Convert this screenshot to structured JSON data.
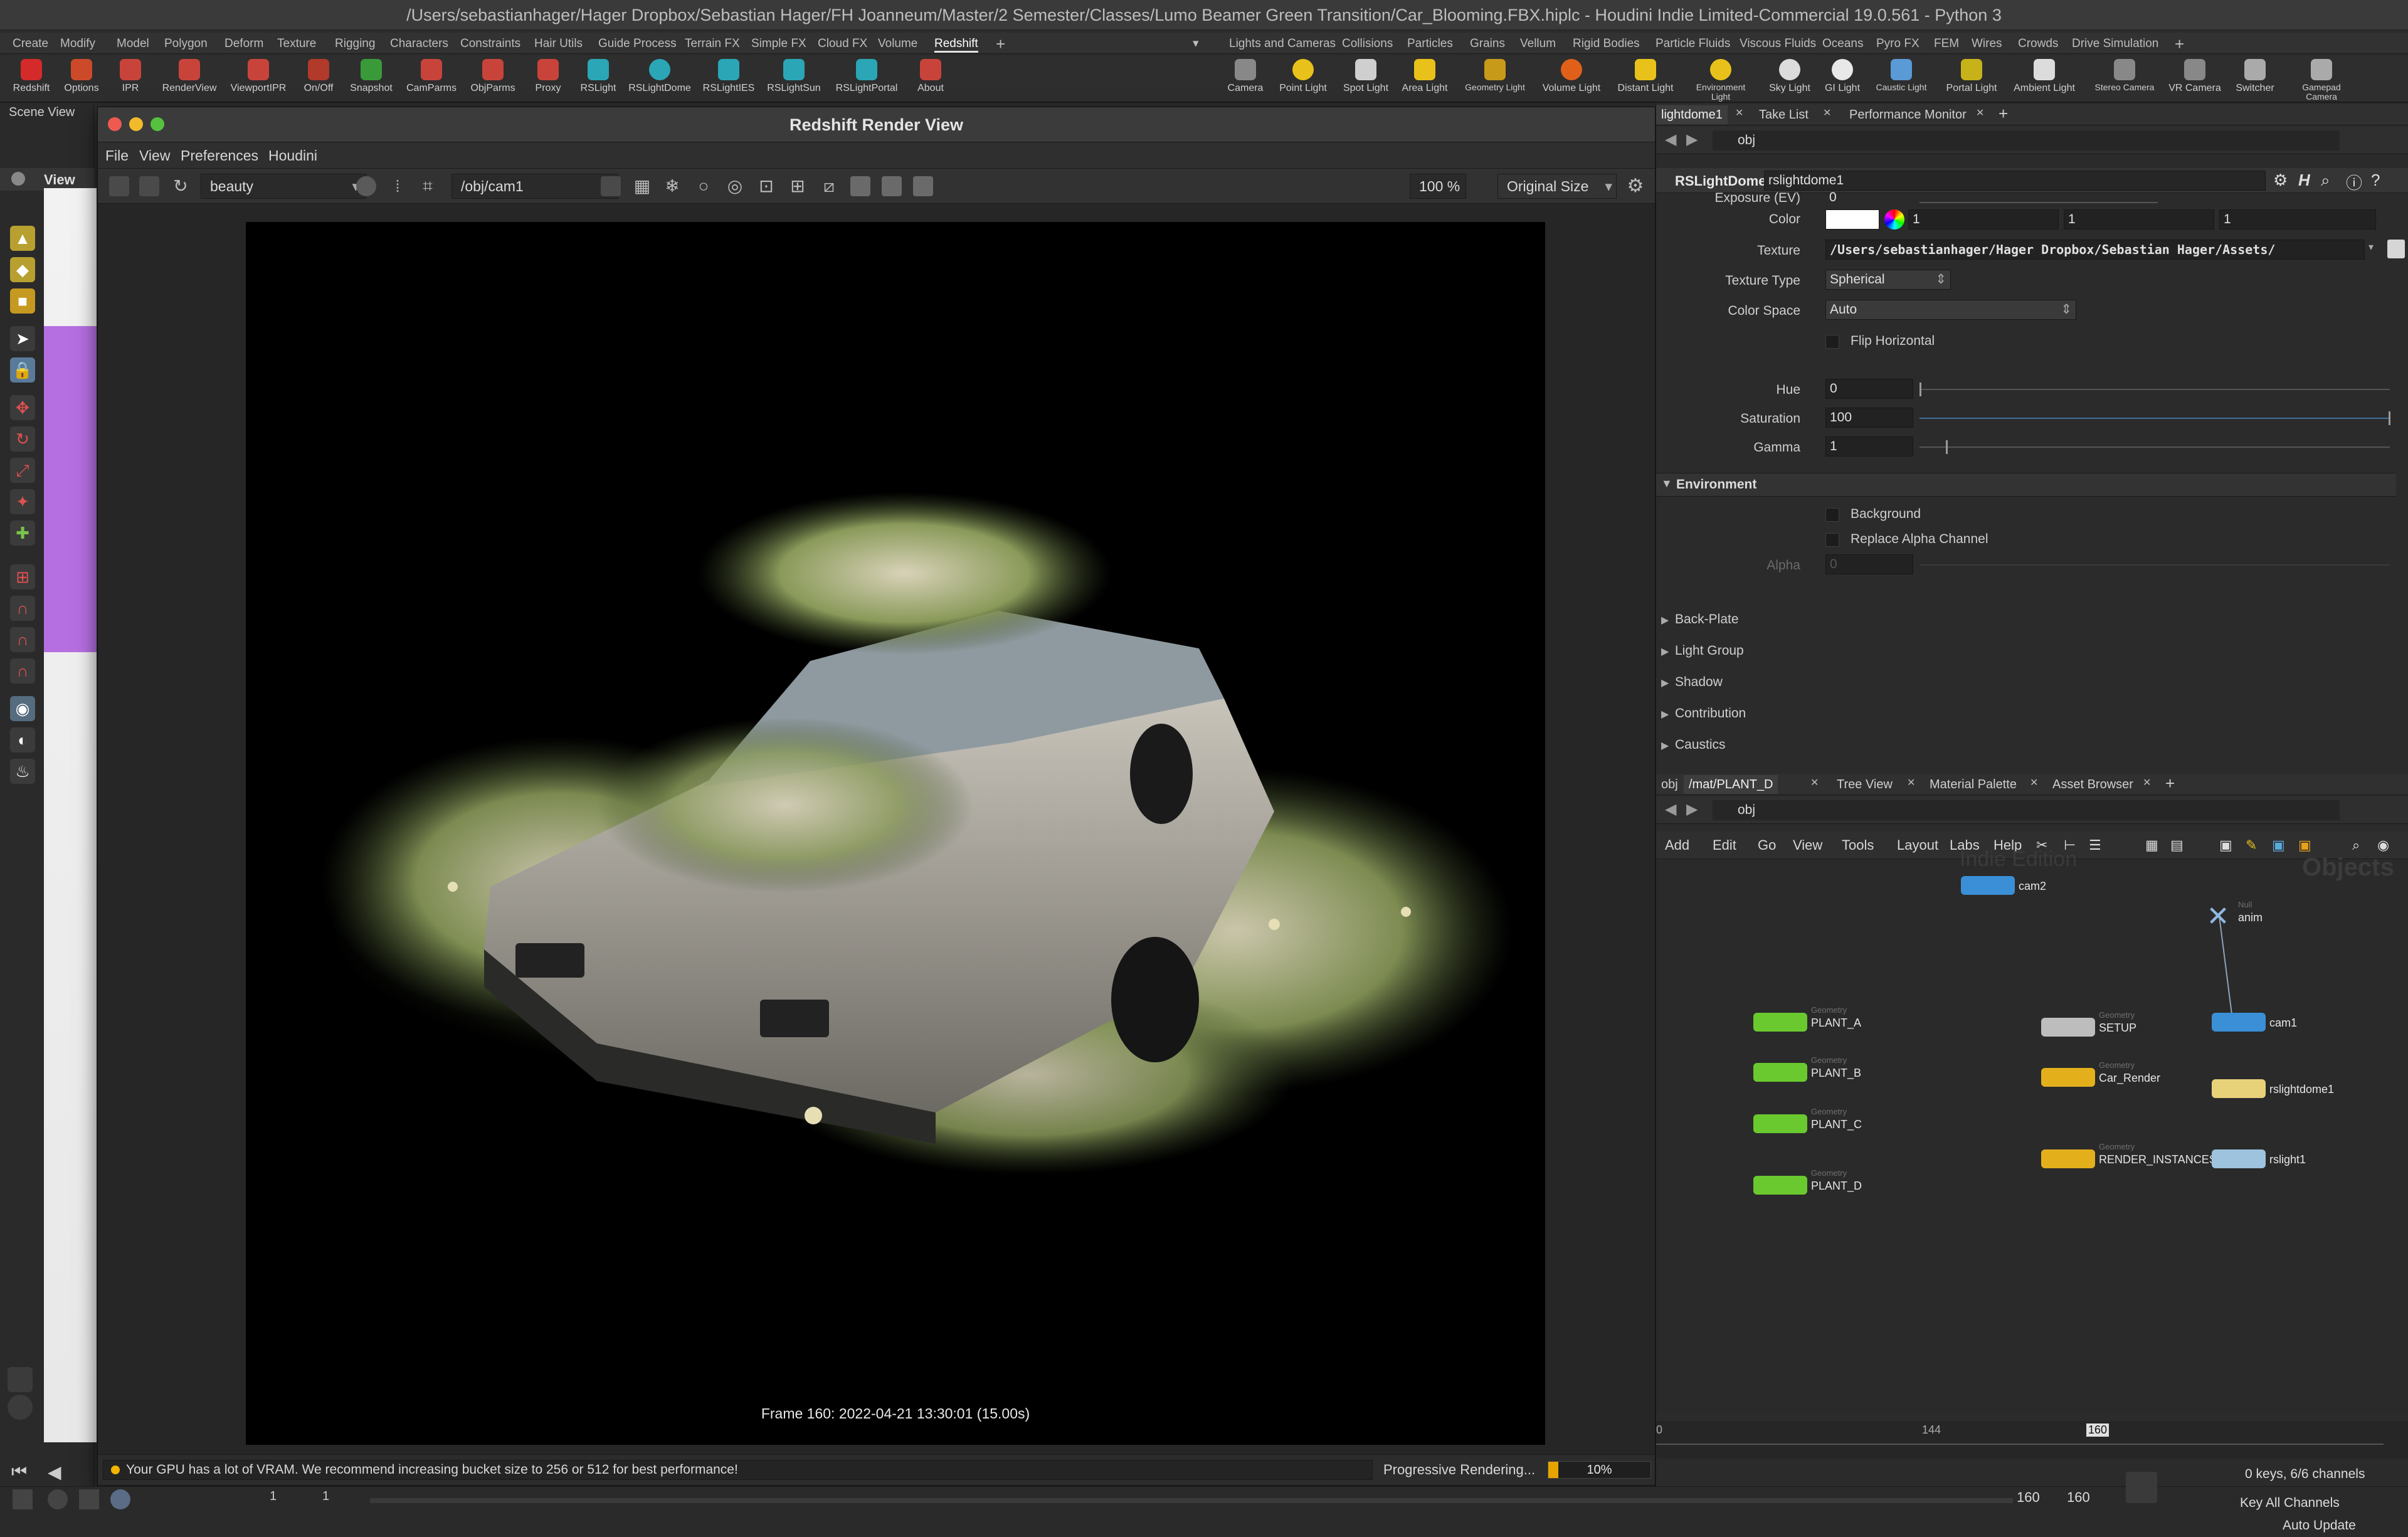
{
  "window_title": "/Users/sebastianhager/Hager Dropbox/Sebastian Hager/FH Joanneum/Master/2 Semester/Classes/Lumo Beamer Green Transition/Car_Blooming.FBX.hiplc - Houdini Indie Limited-Commercial 19.0.561 - Python 3",
  "shelf_tabs_left": [
    "Create",
    "Modify",
    "Model",
    "Polygon",
    "Deform",
    "Texture",
    "Rigging",
    "Characters",
    "Constraints",
    "Hair Utils",
    "Guide Process",
    "Terrain FX",
    "Simple FX",
    "Cloud FX",
    "Volume",
    "Redshift"
  ],
  "shelf_tabs_right": [
    "Lights and Cameras",
    "Collisions",
    "Particles",
    "Grains",
    "Vellum",
    "Rigid Bodies",
    "Particle Fluids",
    "Viscous Fluids",
    "Oceans",
    "Pyro FX",
    "FEM",
    "Wires",
    "Crowds",
    "Drive Simulation"
  ],
  "shelf_tools_left": [
    "Redshift",
    "Options",
    "IPR",
    "RenderView",
    "ViewportIPR",
    "On/Off",
    "Snapshot",
    "CamParms",
    "ObjParms",
    "Proxy",
    "RSLight",
    "RSLightDome",
    "RSLightIES",
    "RSLightSun",
    "RSLightPortal",
    "About"
  ],
  "shelf_tools_right": [
    "Camera",
    "Point Light",
    "Spot Light",
    "Area Light",
    "Geometry Light",
    "Volume Light",
    "Distant Light",
    "Environment Light",
    "Sky Light",
    "GI Light",
    "Caustic Light",
    "Portal Light",
    "Ambient Light",
    "Stereo Camera",
    "VR Camera",
    "Switcher",
    "Gamepad Camera"
  ],
  "left_pane": {
    "scene_view_tab": "Scene View",
    "view_label": "View"
  },
  "render_view": {
    "title": "Redshift Render View",
    "menu": [
      "File",
      "View",
      "Preferences",
      "Houdini"
    ],
    "aov": "beauty",
    "camera": "/obj/cam1",
    "zoom": "100 %",
    "size_mode": "Original Size",
    "frame_caption": "Frame  160:  2022-04-21  13:30:01  (15.00s)",
    "warning": "Your GPU has a lot of VRAM. We recommend increasing bucket size to 256 or 512 for best performance!",
    "progress_label": "Progressive Rendering...",
    "progress_text": "10%",
    "progress_value": 0.1
  },
  "param_tabs": [
    "lightdome1",
    "Take List",
    "Performance Monitor"
  ],
  "param_path": "obj",
  "param_header": {
    "type": "RSLightDome",
    "name": "rslightdome1"
  },
  "params": {
    "exposure_label": "Exposure (EV)",
    "exposure": "0",
    "color_label": "Color",
    "color_r": "1",
    "color_g": "1",
    "color_b": "1",
    "texture_label": "Texture",
    "texture": "/Users/sebastianhager/Hager Dropbox/Sebastian Hager/Assets/",
    "texture_type_label": "Texture Type",
    "texture_type": "Spherical",
    "color_space_label": "Color Space",
    "color_space": "Auto",
    "flip_label": "Flip Horizontal",
    "hue_label": "Hue",
    "hue": "0",
    "saturation_label": "Saturation",
    "saturation": "100",
    "gamma_label": "Gamma",
    "gamma": "1",
    "environment_label": "Environment",
    "background_label": "Background",
    "replace_alpha_label": "Replace Alpha Channel",
    "alpha_label": "Alpha",
    "alpha": "0",
    "folders": [
      "Back-Plate",
      "Light Group",
      "Shadow",
      "Contribution",
      "Caustics"
    ]
  },
  "net_tabs": [
    "obj",
    "/mat/PLANT_D",
    "Tree View",
    "Material Palette",
    "Asset Browser"
  ],
  "net_path": "obj",
  "net_menu": [
    "Add",
    "Edit",
    "Go",
    "View",
    "Tools",
    "Layout",
    "Labs",
    "Help"
  ],
  "net_watermark": {
    "left": "Indie Edition",
    "right": "Objects"
  },
  "nodes": [
    {
      "name": "cam2",
      "type": "",
      "color": "#3a8fd6"
    },
    {
      "name": "anim",
      "type": "Null",
      "color": "#8fb8e0"
    },
    {
      "name": "PLANT_A",
      "type": "Geometry",
      "color": "#6ac92e"
    },
    {
      "name": "SETUP",
      "type": "Geometry",
      "color": "#bdbdbd"
    },
    {
      "name": "cam1",
      "type": "",
      "color": "#3a8fd6"
    },
    {
      "name": "PLANT_B",
      "type": "Geometry",
      "color": "#6ac92e"
    },
    {
      "name": "Car_Render",
      "type": "Geometry",
      "color": "#e3b01c"
    },
    {
      "name": "rslightdome1",
      "type": "",
      "color": "#e7d27a"
    },
    {
      "name": "PLANT_C",
      "type": "Geometry",
      "color": "#6ac92e"
    },
    {
      "name": "RENDER_INSTANCES",
      "type": "Geometry",
      "color": "#e3b01c"
    },
    {
      "name": "rslight1",
      "type": "",
      "color": "#9ec3df"
    },
    {
      "name": "PLANT_D",
      "type": "Geometry",
      "color": "#6ac92e"
    }
  ],
  "timeline": {
    "tick_start": "0",
    "tick_mid": "144",
    "current": "160",
    "end1": "160",
    "end2": "160",
    "start1": "1",
    "start2": "1"
  },
  "channels": {
    "keys": "0 keys, 6/6 channels",
    "key_all": "Key All Channels"
  },
  "auto_update": "Auto Update"
}
